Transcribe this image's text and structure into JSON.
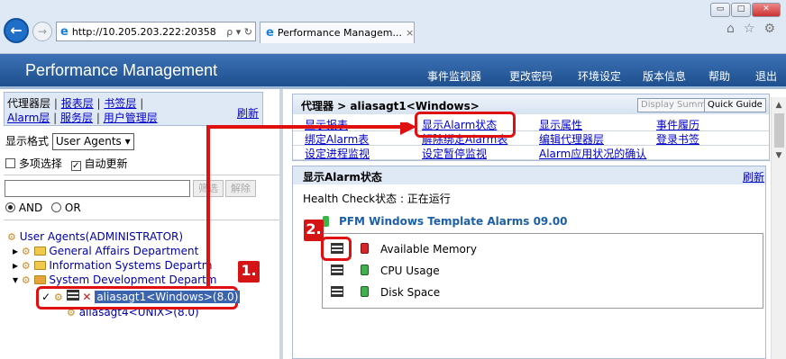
{
  "browser": {
    "url": "http://10.205.203.222:20358",
    "address_controls": "ρ ▾ ↻",
    "tab_title": "Performance Managem...",
    "tab_close": "×",
    "back": "←",
    "forward": "→",
    "window_buttons": [
      "▭",
      "□",
      "✕"
    ],
    "toolbar_icons": [
      "⌂",
      "☆",
      "⚙"
    ]
  },
  "header": {
    "title": "Performance Management",
    "menu": [
      "事件监视器",
      "更改密码",
      "环境设定",
      "版本信息",
      "帮助",
      "退出"
    ]
  },
  "left": {
    "tabs_row1": [
      "代理器层",
      "报表层",
      "书签层"
    ],
    "tabs_row2": [
      "Alarm层",
      "服务层",
      "用户管理层"
    ],
    "refresh": "刷新",
    "format_label": "显示格式",
    "format_value": "User Agents ▾",
    "multi_select": "多项选择",
    "auto_update": "自动更新",
    "filter_btn1": "筛选",
    "filter_btn2": "解除",
    "and": "AND",
    "or": "OR",
    "tree": {
      "root": "User Agents(ADMINISTRATOR)",
      "items": [
        "General Affairs Department",
        "Information Systems Departm",
        "System Development Departm"
      ],
      "selected": "aliasagt1<Windows>(8.0)",
      "next": "aliasagt4<UNIX>(8.0)"
    }
  },
  "right": {
    "breadcrumb_prefix": "代理器 >",
    "breadcrumb_agent": "aliasagt1<Windows>",
    "display_summary": "Display Summary",
    "quick_guide": "Quick Guide",
    "links": [
      [
        "显示报表",
        "显示Alarm状态",
        "显示属性",
        "事件履历"
      ],
      [
        "绑定Alarm表",
        "解除绑定Alarm表",
        "编辑代理器层",
        "登录书签"
      ],
      [
        "设定进程监视",
        "设定暂停监视",
        "Alarm应用状况的确认",
        ""
      ]
    ],
    "alarm_section": "显示Alarm状态",
    "alarm_refresh": "刷新",
    "health_label": "Health Check状态 : 正在运行",
    "alarm_table_title": "PFM Windows Template Alarms 09.00",
    "alarms": [
      "Available Memory",
      "CPU Usage",
      "Disk Space"
    ]
  },
  "annotations": {
    "step1": "1.",
    "step2": "2."
  },
  "colors": {
    "header_blue": "#2a5ea0",
    "highlight_red": "#e01010",
    "link_blue": "#0000cc",
    "status_green": "#3bb54a",
    "status_red": "#d8262c"
  }
}
